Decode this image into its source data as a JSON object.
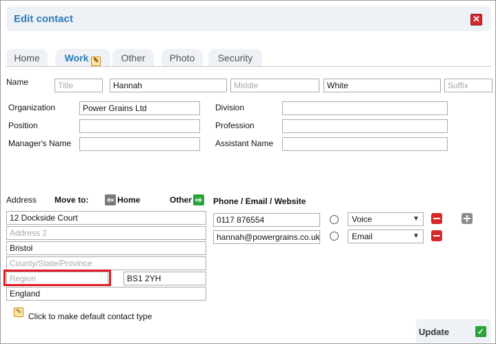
{
  "dialog": {
    "title": "Edit contact",
    "close_symbol": "✕"
  },
  "tabs": [
    {
      "label": "Home"
    },
    {
      "label": "Work"
    },
    {
      "label": "Other"
    },
    {
      "label": "Photo"
    },
    {
      "label": "Security"
    }
  ],
  "name": {
    "label": "Name",
    "title_placeholder": "Title",
    "first_value": "Hannah",
    "middle_placeholder": "Middle",
    "last_value": "White",
    "suffix_placeholder": "Suffix"
  },
  "work": {
    "organization_label": "Organization",
    "organization_value": "Power Grains Ltd",
    "division_label": "Division",
    "position_label": "Position",
    "profession_label": "Profession",
    "managers_name_label": "Manager's Name",
    "assistant_name_label": "Assistant Name"
  },
  "address": {
    "label": "Address",
    "move_to_label": "Move to:",
    "home_label": "Home",
    "other_label": "Other",
    "line1_value": "12 Dockside Court",
    "line2_placeholder": "Address 2",
    "city_value": "Bristol",
    "county_placeholder": "County/State/Province",
    "region_placeholder": "Region",
    "postcode_value": "BS1 2YH",
    "country_value": "England"
  },
  "contact_methods": {
    "header": "Phone / Email / Website",
    "rows": [
      {
        "value": "0117 876554",
        "type": "Voice"
      },
      {
        "value": "hannah@powergrains.co.uk",
        "type": "Email"
      }
    ]
  },
  "default_contact_type_label": "Click to make default contact type",
  "footer": {
    "update_label": "Update"
  },
  "colors": {
    "accent": "#2b7bb9",
    "highlight": "#e01b24",
    "remove": "#d6282c",
    "confirm": "#2aa43a"
  }
}
